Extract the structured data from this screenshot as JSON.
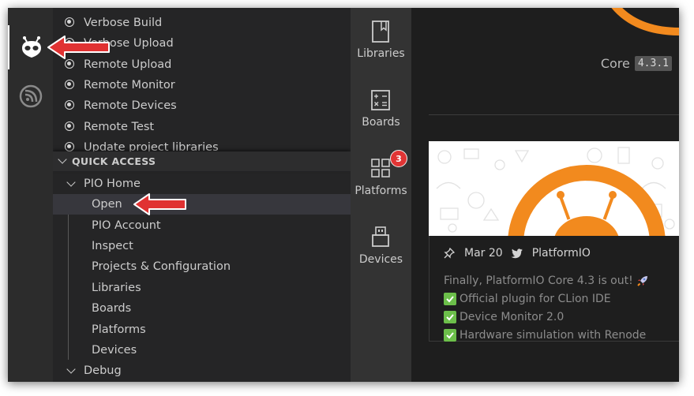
{
  "sidebar": {
    "tasks": [
      "Verbose Build",
      "Verbose Upload",
      "Remote Upload",
      "Remote Monitor",
      "Remote Devices",
      "Remote Test",
      "Update project libraries"
    ],
    "quick_access": {
      "header": "QUICK ACCESS",
      "groups": [
        {
          "label": "PIO Home",
          "items": [
            "Open",
            "PIO Account",
            "Inspect",
            "Projects & Configuration",
            "Libraries",
            "Boards",
            "Platforms",
            "Devices"
          ]
        },
        {
          "label": "Debug",
          "items": []
        }
      ]
    }
  },
  "pio_nav": [
    {
      "label": "Libraries",
      "icon": "book-icon"
    },
    {
      "label": "Boards",
      "icon": "calculator-icon"
    },
    {
      "label": "Platforms",
      "icon": "grid-icon",
      "badge": "3"
    },
    {
      "label": "Devices",
      "icon": "usb-icon"
    }
  ],
  "content": {
    "core_label": "Core",
    "core_version": "4.3.1",
    "news": {
      "date": "Mar 20",
      "author": "PlatformIO",
      "headline": "Finally, PlatformIO Core 4.3 is out!",
      "bullets": [
        "Official plugin for CLion IDE",
        "Device Monitor 2.0",
        "Hardware simulation with Renode"
      ]
    }
  },
  "colors": {
    "accent_orange": "#f28a1e",
    "arrow_red": "#e03232",
    "check_green": "#6cbf4a",
    "badge_red": "#e13535"
  }
}
